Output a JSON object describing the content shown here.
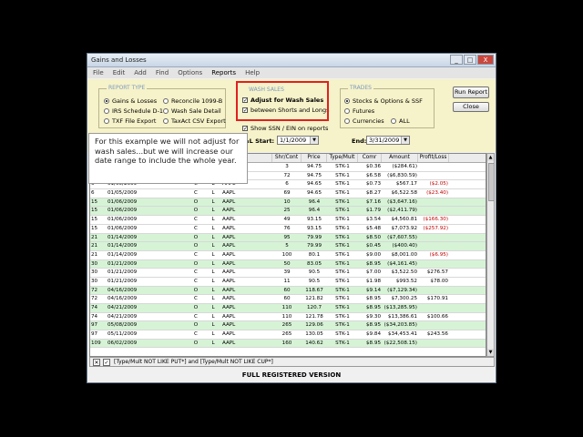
{
  "window": {
    "title": "Gains and Losses",
    "min": "_",
    "max": "□",
    "close": "X"
  },
  "menu": [
    "File",
    "Edit",
    "Add",
    "Find",
    "Options",
    "Reports",
    "Help"
  ],
  "report_type": {
    "label": "REPORT TYPE",
    "options": [
      "Gains & Losses",
      "IRS Schedule D-1",
      "TXF File Export",
      "Reconcile 1099-B",
      "Wash Sale Detail",
      "TaxAct CSV Export"
    ],
    "selected": "Gains & Losses"
  },
  "wash_sales": {
    "label": "WASH SALES",
    "adjust": "Adjust for Wash Sales",
    "between": "between Shorts and Longs"
  },
  "trades": {
    "label": "TRADES",
    "options": [
      "Stocks & Options & SSF",
      "Futures",
      "Currencies",
      "ALL"
    ],
    "selected": "Stocks & Options & SSF"
  },
  "buttons": {
    "run": "Run Report",
    "close": "Close"
  },
  "show_ssn": "Show SSN / EIN on reports",
  "dates": {
    "start_label": "&L Start:",
    "start": "1/1/2009",
    "end_label": "End:",
    "end": "3/31/2009"
  },
  "tooltip": "For this example we will not adjust for wash sales...but we will increase our date range to include the whole year.",
  "table": {
    "headers": [
      "",
      "",
      "",
      "",
      "",
      "",
      "Shr/Cont",
      "Price",
      "Type/Mult",
      "Comr",
      "Amount",
      "Profit/Loss"
    ],
    "rows": [
      {
        "g": false,
        "c": [
          "",
          "",
          "",
          "",
          "",
          "",
          "3",
          "94.75",
          "STK-1",
          "$0.36",
          "($284.61)",
          ""
        ]
      },
      {
        "g": false,
        "c": [
          "",
          "",
          "",
          "",
          "",
          "",
          "72",
          "94.75",
          "STK-1",
          "$6.58",
          "($6,830.59)",
          ""
        ]
      },
      {
        "g": false,
        "c": [
          "6",
          "01/05/2009",
          "",
          "C",
          "L",
          "AAPL",
          "6",
          "94.65",
          "STK-1",
          "$0.73",
          "$567.17",
          "($2.05)"
        ]
      },
      {
        "g": false,
        "c": [
          "6",
          "01/05/2009",
          "",
          "C",
          "L",
          "AAPL",
          "69",
          "94.65",
          "STK-1",
          "$8.27",
          "$6,522.58",
          "($23.40)"
        ]
      },
      {
        "g": true,
        "c": [
          "15",
          "01/06/2009",
          "",
          "O",
          "L",
          "AAPL",
          "10",
          "96.4",
          "STK-1",
          "$7.16",
          "($3,647.16)",
          ""
        ]
      },
      {
        "g": true,
        "c": [
          "15",
          "01/06/2009",
          "",
          "O",
          "L",
          "AAPL",
          "25",
          "96.4",
          "STK-1",
          "$1.79",
          "($2,411.79)",
          ""
        ]
      },
      {
        "g": false,
        "c": [
          "15",
          "01/06/2009",
          "",
          "C",
          "L",
          "AAPL",
          "49",
          "93.15",
          "STK-1",
          "$3.54",
          "$4,560.81",
          "($166.30)"
        ]
      },
      {
        "g": false,
        "c": [
          "15",
          "01/06/2009",
          "",
          "C",
          "L",
          "AAPL",
          "76",
          "93.15",
          "STK-1",
          "$5.48",
          "$7,073.92",
          "($257.92)"
        ]
      },
      {
        "g": true,
        "c": [
          "21",
          "01/14/2009",
          "",
          "O",
          "L",
          "AAPL",
          "95",
          "79.99",
          "STK-1",
          "$8.50",
          "($7,607.55)",
          ""
        ]
      },
      {
        "g": true,
        "c": [
          "21",
          "01/14/2009",
          "",
          "O",
          "L",
          "AAPL",
          "5",
          "79.99",
          "STK-1",
          "$0.45",
          "($400.40)",
          ""
        ]
      },
      {
        "g": false,
        "c": [
          "21",
          "01/14/2009",
          "",
          "C",
          "L",
          "AAPL",
          "100",
          "80.1",
          "STK-1",
          "$9.00",
          "$8,001.00",
          "($6.95)"
        ]
      },
      {
        "g": true,
        "c": [
          "30",
          "01/21/2009",
          "",
          "O",
          "L",
          "AAPL",
          "50",
          "83.05",
          "STK-1",
          "$8.95",
          "($4,161.45)",
          ""
        ]
      },
      {
        "g": false,
        "c": [
          "30",
          "01/21/2009",
          "",
          "C",
          "L",
          "AAPL",
          "39",
          "90.5",
          "STK-1",
          "$7.00",
          "$3,522.50",
          "$276.57"
        ]
      },
      {
        "g": false,
        "c": [
          "30",
          "01/21/2009",
          "",
          "C",
          "L",
          "AAPL",
          "11",
          "90.5",
          "STK-1",
          "$1.98",
          "$993.52",
          "$78.00"
        ]
      },
      {
        "g": true,
        "c": [
          "72",
          "04/16/2009",
          "",
          "O",
          "L",
          "AAPL",
          "60",
          "118.67",
          "STK-1",
          "$9.14",
          "($7,129.34)",
          ""
        ]
      },
      {
        "g": false,
        "c": [
          "72",
          "04/16/2009",
          "",
          "C",
          "L",
          "AAPL",
          "60",
          "121.82",
          "STK-1",
          "$8.95",
          "$7,300.25",
          "$170.91"
        ]
      },
      {
        "g": true,
        "c": [
          "74",
          "04/21/2009",
          "",
          "O",
          "L",
          "AAPL",
          "110",
          "120.7",
          "STK-1",
          "$8.95",
          "($13,285.95)",
          ""
        ]
      },
      {
        "g": false,
        "c": [
          "74",
          "04/21/2009",
          "",
          "C",
          "L",
          "AAPL",
          "110",
          "121.78",
          "STK-1",
          "$9.30",
          "$13,386.61",
          "$100.66"
        ]
      },
      {
        "g": true,
        "c": [
          "97",
          "05/08/2009",
          "",
          "O",
          "L",
          "AAPL",
          "265",
          "129.06",
          "STK-1",
          "$8.95",
          "($34,203.85)",
          ""
        ]
      },
      {
        "g": false,
        "c": [
          "97",
          "05/11/2009",
          "",
          "C",
          "L",
          "AAPL",
          "265",
          "130.05",
          "STK-1",
          "$9.84",
          "$34,453.41",
          "$243.56"
        ]
      },
      {
        "g": true,
        "c": [
          "109",
          "06/02/2009",
          "",
          "O",
          "L",
          "AAPL",
          "160",
          "140.62",
          "STK-1",
          "$8.95",
          "($22,508.15)",
          ""
        ]
      }
    ]
  },
  "filter": "[Type/Mult NOT LIKE PUT*] and [Type/Mult NOT LIKE CUP*]",
  "status": "FULL REGISTERED VERSION"
}
